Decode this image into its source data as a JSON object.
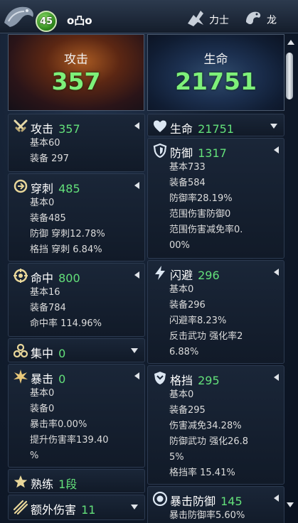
{
  "header": {
    "level": "45",
    "player_name": "o凸o",
    "class_label": "力士",
    "race_label": "龙"
  },
  "hero": {
    "attack": {
      "label": "攻击",
      "value": "357"
    },
    "hp": {
      "label": "生命",
      "value": "21751"
    }
  },
  "left": {
    "attack": {
      "title": "攻击",
      "value": "357",
      "lines": [
        "基本60",
        "装备 297"
      ]
    },
    "pierce": {
      "title": "穿刺",
      "value": "485",
      "lines": [
        "基本0",
        "装备485",
        "防御 穿刺12.78%",
        "格挡 穿刺 6.84%"
      ]
    },
    "accuracy": {
      "title": "命中",
      "value": "800",
      "lines": [
        "基本16",
        "装备784",
        "命中率 114.96%"
      ]
    },
    "focus": {
      "title": "集中",
      "value": "0"
    },
    "critical": {
      "title": "暴击",
      "value": "0",
      "lines": [
        "基本0",
        "装备0",
        "暴击率0.00%",
        "提升伤害率139.40",
        "%"
      ]
    },
    "mastery": {
      "title": "熟练",
      "value": "1段"
    },
    "extra_damage": {
      "title": "额外伤害",
      "value": "11"
    }
  },
  "right": {
    "hp": {
      "title": "生命",
      "value": "21751"
    },
    "defense": {
      "title": "防御",
      "value": "1317",
      "lines": [
        "基本733",
        "装备584",
        "防御率28.19%",
        "范围伤害防御0",
        "范围伤害减免率0.",
        "00%"
      ]
    },
    "evasion": {
      "title": "闪避",
      "value": "296",
      "lines": [
        "基本0",
        "装备296",
        "闪避率8.23%",
        "反击武功 强化率2",
        "6.88%"
      ]
    },
    "block": {
      "title": "格挡",
      "value": "295",
      "lines": [
        "基本0",
        "装备295",
        "伤害减免34.28%",
        "防御武功 强化26.8",
        "5%",
        "格挡率 15.41%"
      ]
    },
    "crit_defense": {
      "title": "暴击防御",
      "value": "145",
      "lines": [
        "暴击防御率5.60%"
      ]
    }
  },
  "colors": {
    "value_green": "#63e07a",
    "hero_green": "#7ef07a"
  }
}
